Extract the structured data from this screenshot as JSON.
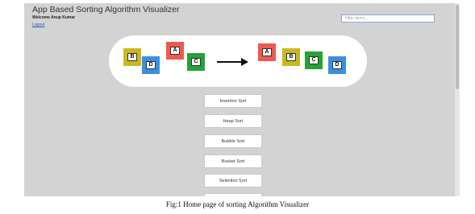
{
  "app": {
    "title": "App Based Sorting Algorithm Visualizer",
    "welcome": "Welcome Anup Kumar",
    "logout_label": "Logout"
  },
  "filter": {
    "placeholder": "Filter items..."
  },
  "banner": {
    "before_blocks": [
      {
        "letter": "B",
        "color": "#c9b81e"
      },
      {
        "letter": "D",
        "color": "#3b8fe0"
      },
      {
        "letter": "A",
        "color": "#ef5a4e"
      },
      {
        "letter": "C",
        "color": "#25a336"
      }
    ],
    "after_blocks": [
      {
        "letter": "A",
        "color": "#ef5a4e"
      },
      {
        "letter": "B",
        "color": "#c9b81e"
      },
      {
        "letter": "C",
        "color": "#25a336"
      },
      {
        "letter": "D",
        "color": "#3b8fe0"
      }
    ],
    "arrow_icon": "right-arrow-icon"
  },
  "algorithms": [
    "Insertion Sort",
    "Heap Sort",
    "Bubble Sort",
    "Bucket Sort",
    "Selection Sort"
  ],
  "caption": "Fig:1 Home page of sorting Algorithm Visualizer"
}
